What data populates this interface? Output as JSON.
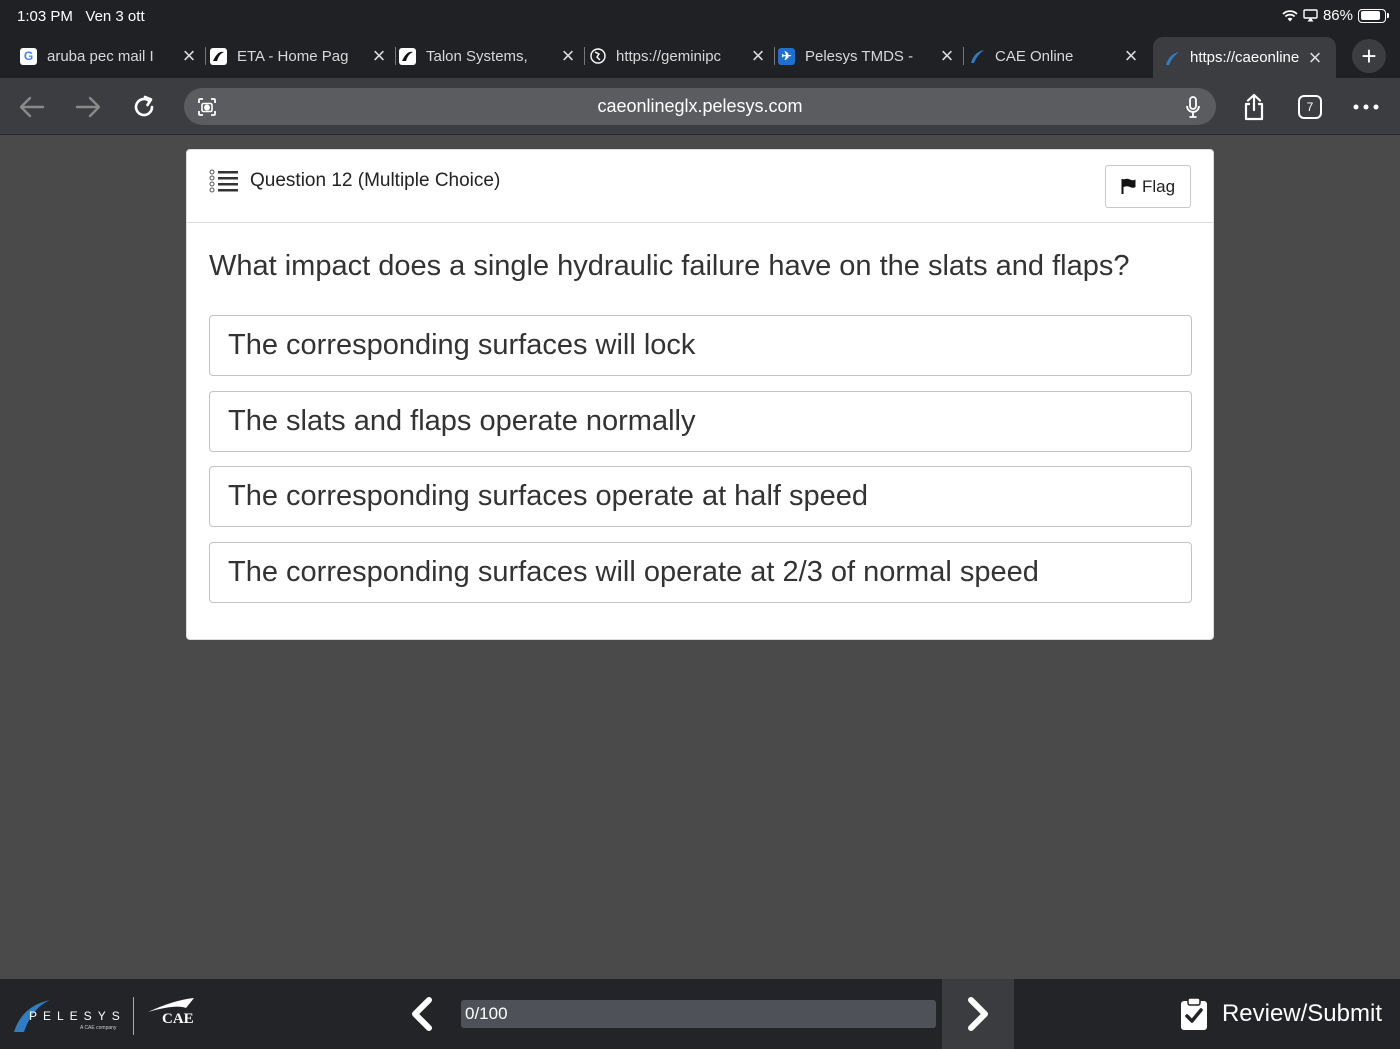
{
  "status": {
    "time": "1:03 PM",
    "date": "Ven 3 ott",
    "battery": "86%",
    "battery_level": 0.86
  },
  "tabs": [
    {
      "title": "aruba pec mail I",
      "icon": "google-icon"
    },
    {
      "title": "ETA - Home Pag",
      "icon": "eta-logo-icon"
    },
    {
      "title": "Talon Systems,",
      "icon": "talon-logo-icon"
    },
    {
      "title": "https://geminipc",
      "icon": "globe-icon"
    },
    {
      "title": "Pelesys TMDS -",
      "icon": "plane-icon"
    },
    {
      "title": "CAE Online",
      "icon": "pelesys-icon"
    },
    {
      "title": "https://caeonline",
      "icon": "pelesys-icon"
    }
  ],
  "toolbar": {
    "url": "caeonlineglx.pelesys.com",
    "tab_count": "7"
  },
  "question": {
    "header": "Question 12 (Multiple Choice)",
    "flag_label": "Flag",
    "text": "What impact does a single hydraulic failure have on the slats and flaps?",
    "options": [
      "The corresponding surfaces will lock",
      "The slats and flaps operate normally",
      "The corresponding surfaces operate at half speed",
      "The corresponding surfaces will operate at 2/3 of normal speed"
    ]
  },
  "footer": {
    "pelesys_logo": "PELESYS",
    "pelesys_sub": "A CAE company",
    "cae_logo": "CAE",
    "progress_label": "0/100",
    "progress_value": 0,
    "review_label": "Review/Submit"
  },
  "colors": {
    "accent": "#2f7ec4",
    "page_bg": "#4a4a4a",
    "chrome_dark": "#202124"
  }
}
